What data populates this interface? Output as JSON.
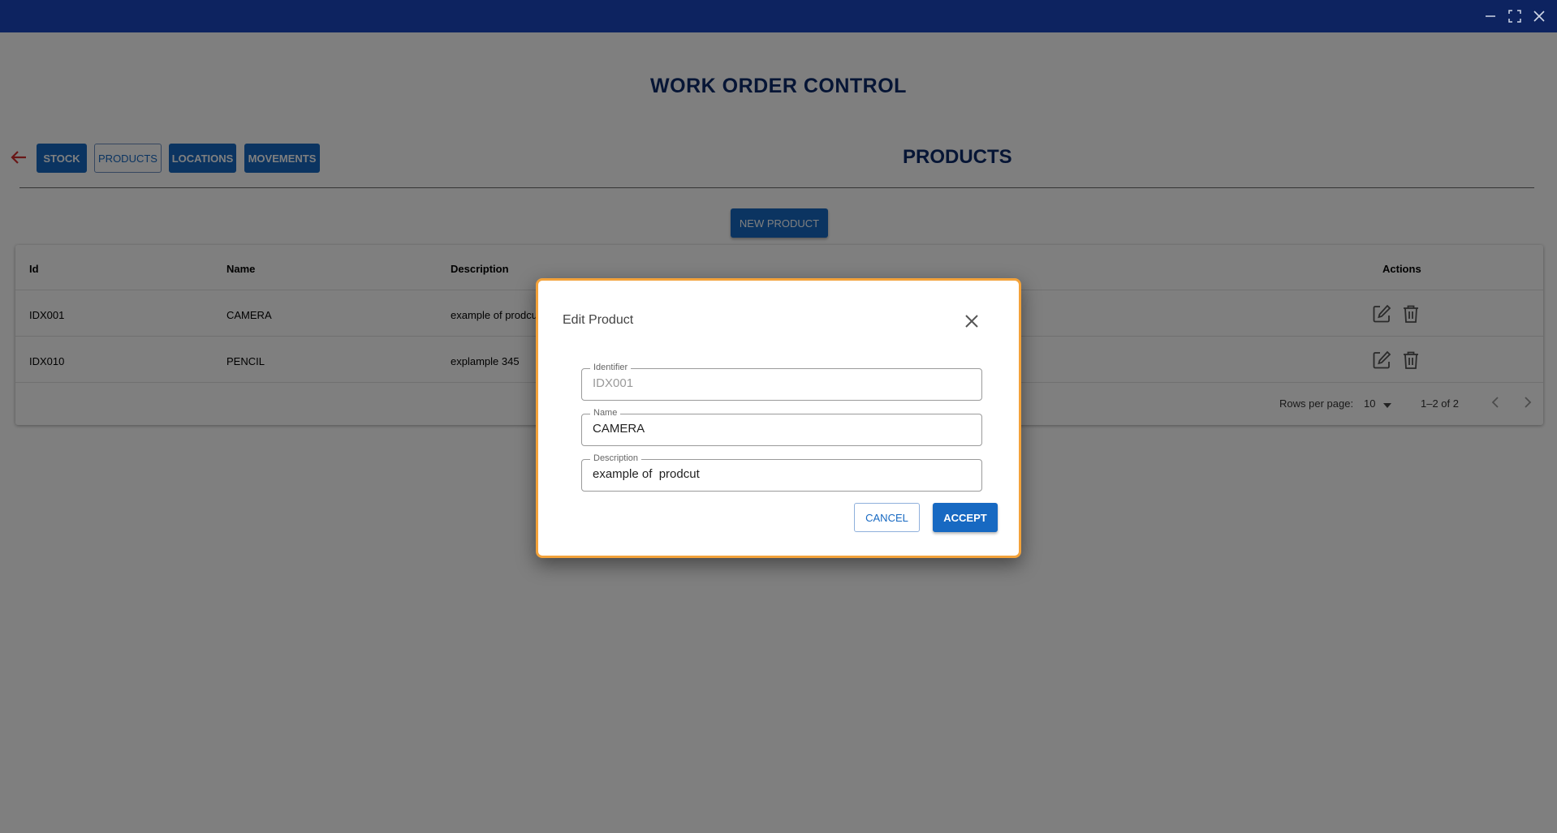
{
  "app": {
    "title": "WORK ORDER CONTROL"
  },
  "window_controls": {
    "minimize": "minimize-icon",
    "maximize": "maximize-icon",
    "close": "close-icon"
  },
  "nav": {
    "back_icon": "arrow-left-icon",
    "buttons": [
      {
        "label": "STOCK",
        "active": false
      },
      {
        "label": "PRODUCTS",
        "active": true
      },
      {
        "label": "LOCATIONS",
        "active": false
      },
      {
        "label": "MOVEMENTS",
        "active": false
      }
    ]
  },
  "section": {
    "title": "PRODUCTS",
    "new_button": "NEW PRODUCT"
  },
  "table": {
    "columns": [
      "Id",
      "Name",
      "Description",
      "Actions"
    ],
    "rows": [
      {
        "id": "IDX001",
        "name": "CAMERA",
        "description": "example of  prodcut"
      },
      {
        "id": "IDX010",
        "name": "PENCIL",
        "description": "explample 345"
      }
    ],
    "action_icons": [
      "edit-icon",
      "trash-icon"
    ],
    "pagination": {
      "rows_per_page_label": "Rows per page:",
      "rows_per_page": "10",
      "range": "1–2 of 2"
    }
  },
  "dialog": {
    "title": "Edit Product",
    "fields": [
      {
        "label": "Identifier",
        "value": "IDX001",
        "disabled": true
      },
      {
        "label": "Name",
        "value": "CAMERA",
        "disabled": false
      },
      {
        "label": "Description",
        "value": "example of  prodcut",
        "disabled": false
      }
    ],
    "cancel_label": "CANCEL",
    "accept_label": "ACCEPT"
  },
  "colors": {
    "titlebar": "#0d2360",
    "primary": "#1769c2",
    "heading": "#0d2a6b",
    "back_arrow": "#d32f2f",
    "dialog_border": "#f3a23a"
  }
}
